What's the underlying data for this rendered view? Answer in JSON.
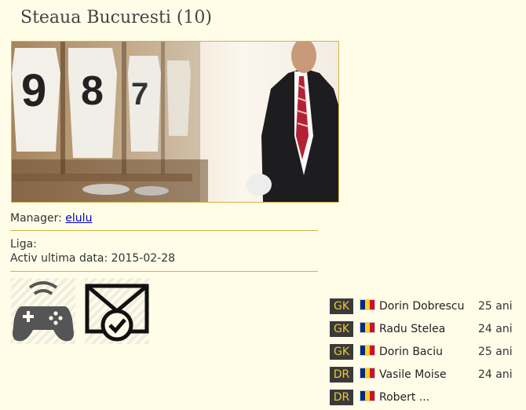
{
  "team": {
    "title": "Steaua Bucuresti (10)"
  },
  "banner": {
    "jersey_numbers": [
      "9",
      "8",
      "7"
    ]
  },
  "info": {
    "manager_label": "Manager:",
    "manager_name": "elulu",
    "liga_label": "Liga:",
    "activ_label": "Activ ultima data:",
    "activ_value": "2015-02-28"
  },
  "icons": [
    "gamepad-icon",
    "mail-check-icon"
  ],
  "flag_colors": [
    "#002b7f",
    "#fcd116",
    "#ce1126"
  ],
  "colors": {
    "accent": "#d4b24a",
    "position_badge_bg": "#3a3a3a",
    "position_badge_text": "#f0c832"
  },
  "players": [
    {
      "pos": "GK",
      "name": "Dorin Dobrescu",
      "age": "25 ani"
    },
    {
      "pos": "GK",
      "name": "Radu Stelea",
      "age": "24 ani"
    },
    {
      "pos": "GK",
      "name": "Dorin Baciu",
      "age": "25 ani"
    },
    {
      "pos": "DR",
      "name": "Vasile Moise",
      "age": "24 ani"
    },
    {
      "pos": "DR",
      "name": "Robert ...",
      "age": ""
    }
  ]
}
